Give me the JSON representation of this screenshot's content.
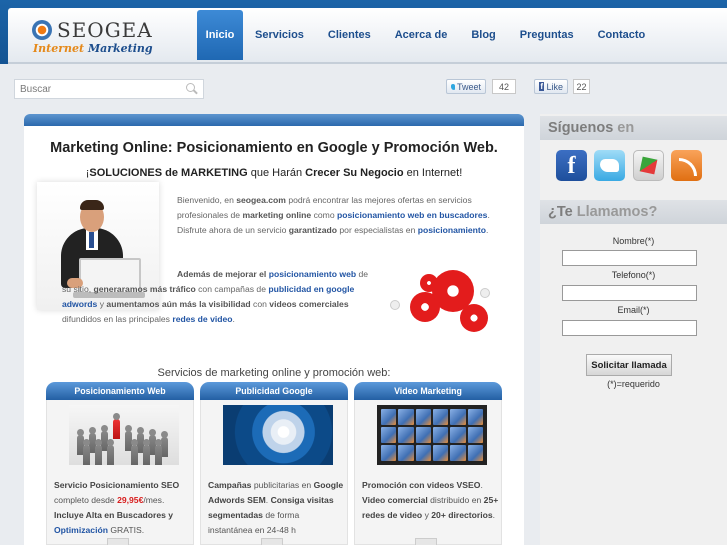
{
  "brand": {
    "name": "SEOGEA",
    "tagline_a": "Internet",
    "tagline_b": "Marketing"
  },
  "nav": [
    {
      "label": "Inicio"
    },
    {
      "label": "Servicios"
    },
    {
      "label": "Clientes"
    },
    {
      "label": "Acerca de"
    },
    {
      "label": "Blog"
    },
    {
      "label": "Preguntas"
    },
    {
      "label": "Contacto"
    }
  ],
  "search": {
    "placeholder": "Buscar"
  },
  "social": {
    "tweet_label": "Tweet",
    "tweet_count": "42",
    "like_label": "Like",
    "like_count": "22"
  },
  "main": {
    "title": "Marketing Online: Posicionamiento en Google y Promoción Web.",
    "subtitle_a": "¡",
    "subtitle_b": "SOLUCIONES de MARKETING",
    "subtitle_c": " que Harán ",
    "subtitle_d": "Crecer Su Negocio",
    "subtitle_e": " en Internet!",
    "intro": {
      "t1": "Bienvenido, en ",
      "site": "seogea.com",
      "t2": " podrá encontrar las mejores ofertas en servicios profesionales de ",
      "mo": "marketing online",
      "t3": " como ",
      "link1": "posicionamiento web en buscadores",
      "t4": ". Disfrute ahora de un servicio ",
      "garant": "garantizado",
      "t5": " por especialistas en ",
      "link2": "posicionamiento",
      "t6": "."
    },
    "p2": {
      "b1": "Además de mejorar el ",
      "link1": "posicionamiento web",
      "t1": " de su sitio, ",
      "b2": "generaramos más tráfico",
      "t2": " con campañas de ",
      "link2": "publicidad en google adwords",
      "t3": " y ",
      "b3": "aumentamos aún más la visibilidad",
      "t4": " con ",
      "b4": "videos comerciales",
      "t5": " difundidos en las principales ",
      "link3": "redes de video",
      "t6": "."
    },
    "services_title": "Servicios de marketing online y promoción web:",
    "columns": [
      {
        "head": "Posicionamiento Web",
        "a": "Servicio Posicionamiento SEO",
        "b": " completo desde ",
        "price": "29,95€",
        "c": "/mes. ",
        "d": "Incluye Alta en Buscadores y ",
        "e": "Optimización",
        "f": " GRATIS."
      },
      {
        "head": "Publicidad Google",
        "a": "Campañas",
        "b": " publicitarias en ",
        "c": "Google Adwords SEM",
        "d": ". ",
        "e": "Consiga visitas segmentadas",
        "f": " de forma instantánea en 24-48 h"
      },
      {
        "head": "Video Marketing",
        "a": "Promoción con videos VSEO",
        "b": ". ",
        "c": "Video comercial",
        "d": " distribuido en ",
        "e": "25+ redes de video",
        "f": " y ",
        "g": "20+ directorios",
        "h": "."
      }
    ]
  },
  "sidebar": {
    "follow_a": "Síguenos",
    "follow_b": " en",
    "call_a": "¿Te",
    "call_b": " Llamamos?",
    "name_label": "Nombre(*)",
    "tel_label": "Telefono(*)",
    "email_label": "Email(*)",
    "submit_label": "Solicitar llamada",
    "required_note": "(*)=requerido"
  }
}
